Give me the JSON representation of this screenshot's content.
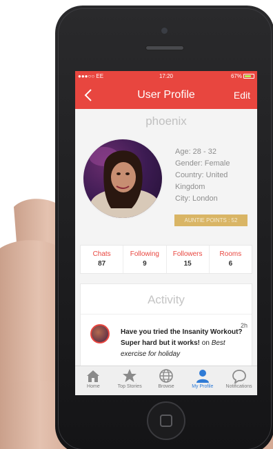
{
  "status_bar": {
    "carrier": "●●●○○ EE",
    "time": "17:20",
    "battery": "67%"
  },
  "navbar": {
    "title": "User Profile",
    "edit_label": "Edit"
  },
  "profile": {
    "username": "phoenix",
    "age": "Age: 28 - 32",
    "gender": "Gender: Female",
    "country": "Country: United Kingdom",
    "city": "City: London",
    "points_badge": "AUNTIE POINTS : 52"
  },
  "stats": [
    {
      "label": "Chats",
      "value": "87"
    },
    {
      "label": "Following",
      "value": "9"
    },
    {
      "label": "Followers",
      "value": "15"
    },
    {
      "label": "Rooms",
      "value": "6"
    }
  ],
  "activity": {
    "header": "Activity",
    "items": [
      {
        "text": "Have you tried the Insanity Workout? Super hard but it works!",
        "on_word": "on",
        "target": "Best exercise for holiday",
        "time": "2h"
      }
    ]
  },
  "tabs": [
    {
      "label": "Home",
      "icon": "home-icon"
    },
    {
      "label": "Top Stories",
      "icon": "star-icon"
    },
    {
      "label": "Browse",
      "icon": "globe-icon"
    },
    {
      "label": "My Profile",
      "icon": "person-icon",
      "active": true
    },
    {
      "label": "Notifications",
      "icon": "speech-bubble-icon"
    }
  ],
  "colors": {
    "accent": "#e8463f",
    "badge": "#d9b565",
    "active_tab": "#2f7bd6"
  }
}
